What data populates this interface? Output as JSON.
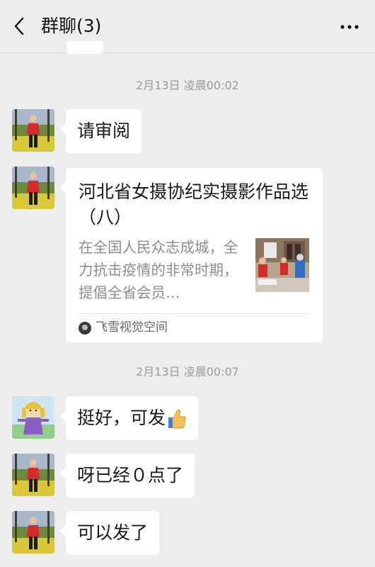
{
  "header": {
    "title": "群聊(3)"
  },
  "messages": [
    {
      "time": "2月13日 凌晨00:02"
    },
    {
      "text": "请审阅"
    },
    {
      "card": {
        "title": "河北省女摄协纪实摄影作品选（八）",
        "description": "在全国人民众志成城，全力抗击疫情的非常时期，提倡全省会员…",
        "source": "飞雪视觉空间"
      }
    },
    {
      "time": "2月13日 凌晨00:07"
    },
    {
      "text": "挺好，可发"
    },
    {
      "text": "呀已经０点了"
    },
    {
      "text": "可以发了"
    }
  ],
  "colors": {
    "background": "#ededed",
    "bubble": "#ffffff",
    "timestamp": "#9b9b9b",
    "card_desc": "#8d8d8d"
  },
  "icons": {
    "back": "chevron-left-icon",
    "more": "more-horizontal-icon",
    "thumbs_up": "thumbs-up-icon",
    "source": "source-avatar-icon"
  }
}
